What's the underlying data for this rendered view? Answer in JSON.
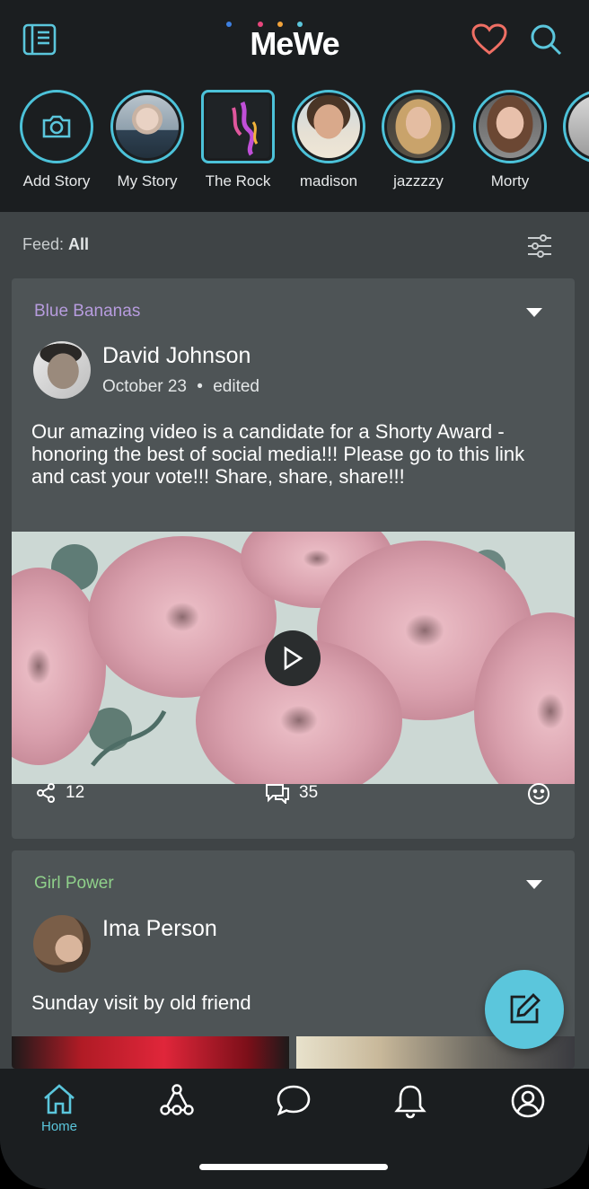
{
  "app": {
    "logo_text": "MeWe",
    "logo_dot_colors": [
      "#3d7fe0",
      "#e8467c",
      "#f2a33a",
      "#5bc6dc"
    ]
  },
  "header": {
    "left_icon": "sidebar-icon",
    "heart_icon": "heart-icon",
    "search_icon": "search-icon"
  },
  "stories": [
    {
      "label": "Add Story",
      "icon": "camera-icon"
    },
    {
      "label": "My Story"
    },
    {
      "label": "The Rock"
    },
    {
      "label": "madison"
    },
    {
      "label": "jazzzzy"
    },
    {
      "label": "Morty"
    }
  ],
  "feed": {
    "prefix": "Feed:",
    "value": "All",
    "filter_icon": "filter-sliders-icon"
  },
  "posts": [
    {
      "group": "Blue Bananas",
      "group_color": "#b79cde",
      "author": "David Johnson",
      "date": "October 23",
      "separator": "•",
      "edited": "edited",
      "text": "Our amazing video is a candidate for a Shorty Award - honoring the best of social media!!! Please go to this link and cast your vote!!! Share, share, share!!!",
      "shares": "12",
      "comments": "35"
    },
    {
      "group": "Girl Power",
      "group_color": "#8fd08a",
      "author": "Ima Person",
      "text": "Sunday visit by old friend"
    }
  ],
  "fab": {
    "icon": "compose-icon"
  },
  "nav": [
    {
      "label": "Home",
      "icon": "home-icon",
      "active": true
    },
    {
      "icon": "network-icon"
    },
    {
      "icon": "chat-icon"
    },
    {
      "icon": "bell-icon"
    },
    {
      "icon": "profile-icon"
    }
  ],
  "accent": "#5bc6dc"
}
